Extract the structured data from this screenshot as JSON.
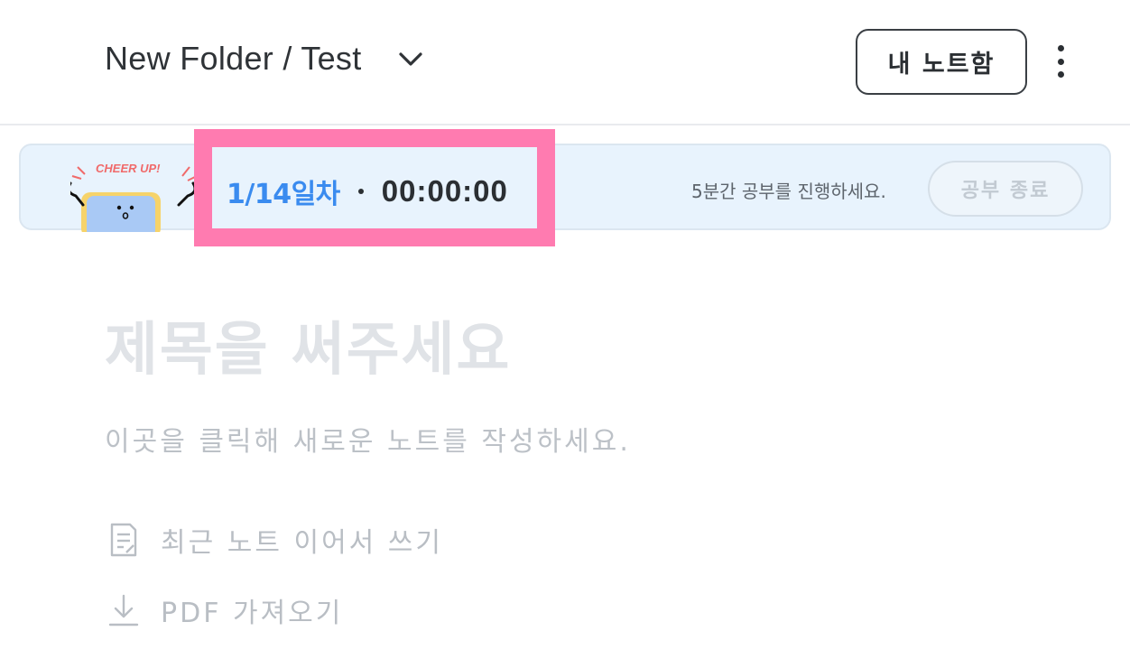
{
  "header": {
    "breadcrumb": "New Folder / Test",
    "notebox_button": "내 노트함",
    "icons": {
      "dropdown": "chevron-down-icon",
      "more": "more-vertical-icon"
    }
  },
  "study_bar": {
    "mascot_text": "CHEER UP!",
    "day_label": "1/14일차",
    "timer": "00:00:00",
    "hint": "5분간 공부를 진행하세요.",
    "end_button": "공부 종료",
    "colors": {
      "background": "#e8f3fd",
      "day": "#3a8bef",
      "highlight": "#ff7bb0"
    }
  },
  "editor": {
    "title_placeholder": "제목을 써주세요",
    "body_placeholder": "이곳을 클릭해 새로운 노트를 작성하세요."
  },
  "actions": [
    {
      "label": "최근 노트 이어서 쓰기",
      "icon": "document-icon"
    },
    {
      "label": "PDF 가져오기",
      "icon": "download-icon"
    }
  ]
}
